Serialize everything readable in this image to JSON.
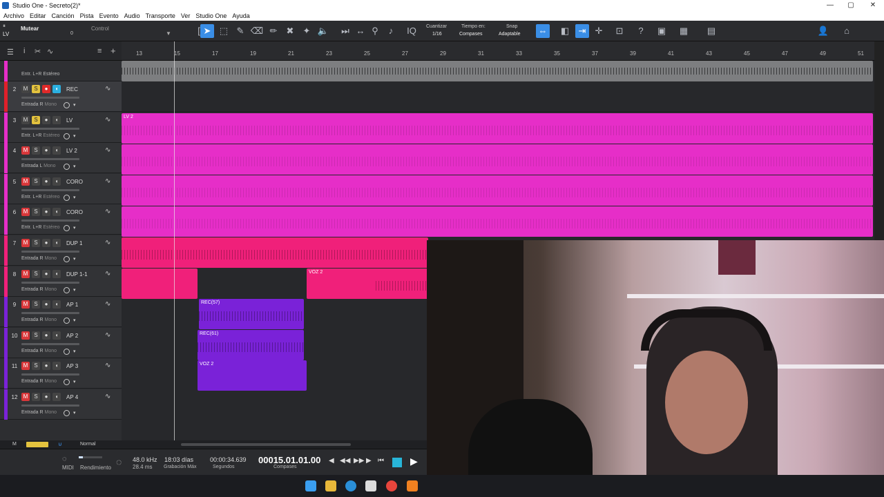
{
  "window": {
    "title": "Studio One - Secreto(2)*",
    "minimize": "—",
    "maximize": "▢",
    "close": "✕"
  },
  "menu": [
    "Archivo",
    "Editar",
    "Canción",
    "Pista",
    "Evento",
    "Audio",
    "Transporte",
    "Ver",
    "Studio One",
    "Ayuda"
  ],
  "toolbar": {
    "track_name": "LV",
    "mute_label": "Mutear",
    "mute_value": "0",
    "control_label": "Control",
    "quantize_label": "Cuantizar",
    "quantize_value": "1/16",
    "timebase_label": "Tiempo en:",
    "timebase_value": "Compases",
    "snap_label": "Snap",
    "snap_value": "Adaptable"
  },
  "ruler": {
    "ticks": [
      "13",
      "15",
      "17",
      "19",
      "21",
      "23",
      "25",
      "27",
      "29",
      "31",
      "33",
      "35",
      "37",
      "39",
      "41",
      "43",
      "45",
      "47",
      "49",
      "51"
    ]
  },
  "tracks": [
    {
      "num": "2",
      "name": "REC",
      "input": "Entrada R",
      "mode": "Mono",
      "color": "#e0202a",
      "rec": true,
      "solo": true,
      "selected": true
    },
    {
      "num": "3",
      "name": "LV",
      "input": "Entr. L+R",
      "mode": "Estéreo",
      "color": "#e62ec8",
      "solo": true
    },
    {
      "num": "4",
      "name": "LV 2",
      "input": "Entrada L",
      "mode": "Mono",
      "color": "#e62ec8",
      "mute": true
    },
    {
      "num": "5",
      "name": "CORO",
      "input": "Entr. L+R",
      "mode": "Estéreo",
      "color": "#e62ec8",
      "mute": true
    },
    {
      "num": "6",
      "name": "CORO",
      "input": "Entr. L+R",
      "mode": "Estéreo",
      "color": "#e62ec8",
      "mute": true
    },
    {
      "num": "7",
      "name": "DUP 1",
      "input": "Entrada R",
      "mode": "Mono",
      "color": "#f0207a",
      "mute": true
    },
    {
      "num": "8",
      "name": "DUP 1-1",
      "input": "Entrada R",
      "mode": "Mono",
      "color": "#f0207a",
      "mute": true
    },
    {
      "num": "9",
      "name": "AP 1",
      "input": "Entrada R",
      "mode": "Mono",
      "color": "#7a22d8",
      "mute": true
    },
    {
      "num": "10",
      "name": "AP 2",
      "input": "Entrada R",
      "mode": "Mono",
      "color": "#7a22d8",
      "mute": true
    },
    {
      "num": "11",
      "name": "AP 3",
      "input": "Entrada R",
      "mode": "Mono",
      "color": "#7a22d8",
      "mute": true
    },
    {
      "num": "12",
      "name": "AP 4",
      "input": "Entrada R",
      "mode": "Mono",
      "color": "#7a22d8",
      "mute": true
    }
  ],
  "clips": {
    "lv_label": "LV 2",
    "voz2_a": "VOZ 2",
    "rec57": "REC(57)",
    "rec61": "REC(61)",
    "voz2_b": "VOZ 2"
  },
  "bottom": {
    "m_label": "M",
    "normal_label": "Normal"
  },
  "transport": {
    "midi": "MIDI",
    "performance": "Rendimiento",
    "sample_rate": "48.0 kHz",
    "latency": "28.4 ms",
    "record_time": "18:03 días",
    "record_max": "Grabación Máx",
    "seconds_value": "00:00:34.639",
    "seconds_label": "Segundos",
    "bars_value": "00015.01.01.00",
    "bars_label": "Compases"
  },
  "colors": {
    "accent": "#3a8ee6",
    "pink": "#e62ec8",
    "rose": "#f0207a",
    "purple": "#7a22d8"
  }
}
